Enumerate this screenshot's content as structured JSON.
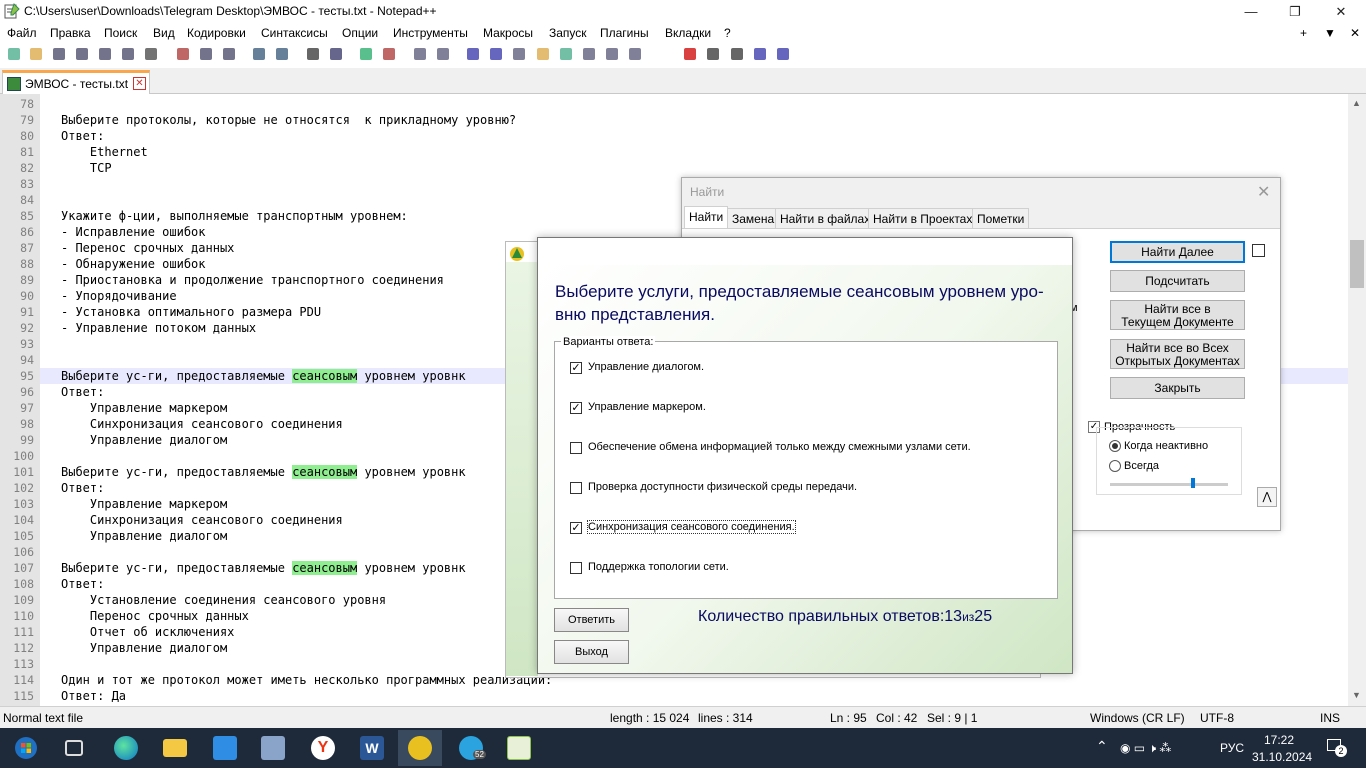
{
  "window": {
    "title": "C:\\Users\\user\\Downloads\\Telegram Desktop\\ЭМВОС - тесты.txt - Notepad++",
    "controls": [
      "—",
      "❐",
      "✕"
    ]
  },
  "menu": [
    "Файл",
    "Правка",
    "Поиск",
    "Вид",
    "Кодировки",
    "Синтаксисы",
    "Опции",
    "Инструменты",
    "Макросы",
    "Запуск",
    "Плагины",
    "Вкладки",
    "?"
  ],
  "menu_right": [
    "+",
    "▼",
    "✕"
  ],
  "tab": {
    "label": "ЭМВОС - тесты.txt"
  },
  "editor": {
    "lines": [
      {
        "n": "78",
        "t": ""
      },
      {
        "n": "79",
        "t": "Выберите протоколы, которые не относятся  к прикладному уровню?"
      },
      {
        "n": "80",
        "t": "Ответ:"
      },
      {
        "n": "81",
        "t": "    Ethernet"
      },
      {
        "n": "82",
        "t": "    TCP"
      },
      {
        "n": "83",
        "t": ""
      },
      {
        "n": "84",
        "t": ""
      },
      {
        "n": "85",
        "t": "Укажите ф-ции, выполняемые транспортным уровнем:"
      },
      {
        "n": "86",
        "t": "- Исправление ошибок"
      },
      {
        "n": "87",
        "t": "- Перенос срочных данных"
      },
      {
        "n": "88",
        "t": "- Обнаружение ошибок"
      },
      {
        "n": "89",
        "t": "- Приостановка и продолжение транспортного соединения"
      },
      {
        "n": "90",
        "t": "- Упорядочивание"
      },
      {
        "n": "91",
        "t": "- Установка оптимального размера PDU"
      },
      {
        "n": "92",
        "t": "- Управление потоком данных"
      },
      {
        "n": "93",
        "t": ""
      },
      {
        "n": "94",
        "t": ""
      },
      {
        "n": "95",
        "pre": "Выберите ус-ги, предоставляемые ",
        "hl": "сеансовым",
        "post": " уровнем уровнк"
      },
      {
        "n": "96",
        "t": "Ответ:"
      },
      {
        "n": "97",
        "t": "    Управление маркером"
      },
      {
        "n": "98",
        "t": "    Синхронизация сеансового соединения"
      },
      {
        "n": "99",
        "t": "    Управление диалогом"
      },
      {
        "n": "100",
        "t": ""
      },
      {
        "n": "101",
        "pre": "Выберите ус-ги, предоставляемые ",
        "hl": "сеансовым",
        "post": " уровнем уровнк"
      },
      {
        "n": "102",
        "t": "Ответ:"
      },
      {
        "n": "103",
        "t": "    Управление маркером"
      },
      {
        "n": "104",
        "t": "    Синхронизация сеансового соединения"
      },
      {
        "n": "105",
        "t": "    Управление диалогом"
      },
      {
        "n": "106",
        "t": ""
      },
      {
        "n": "107",
        "pre": "Выберите ус-ги, предоставляемые ",
        "hl": "сеансовым",
        "post": " уровнем уровнк"
      },
      {
        "n": "108",
        "t": "Ответ:"
      },
      {
        "n": "109",
        "t": "    Установление соединения сеансового уровня"
      },
      {
        "n": "110",
        "t": "    Перенос срочных данных"
      },
      {
        "n": "111",
        "t": "    Отчет об исключениях"
      },
      {
        "n": "112",
        "t": "    Управление диалогом"
      },
      {
        "n": "113",
        "t": ""
      },
      {
        "n": "114",
        "t": "Один и тот же протокол может иметь несколько программных реализации:"
      },
      {
        "n": "115",
        "t": "Ответ: Да"
      }
    ]
  },
  "find_dialog": {
    "title": "Найти",
    "tabs": [
      "Найти",
      "Замена",
      "Найти в файлах",
      "Найти в Проектах",
      "Пометки"
    ],
    "buttons": {
      "find_next": "Найти Далее",
      "count": "Подсчитать",
      "find_all_current": [
        "Найти все в",
        "Текущем Документе"
      ],
      "find_all_open": [
        "Найти все во Всех",
        "Открытых Документах"
      ],
      "close": "Закрыть"
    },
    "partial_label": "м",
    "transparency": "Прозрачность",
    "when_inactive": "Когда неактивно",
    "always": "Всегда"
  },
  "question_dialog": {
    "question": "Выберите услуги, предоставляемые сеансовым уровнем уро-вню представления.",
    "group_label": "Варианты ответа:",
    "options": [
      {
        "label": "Управление диалогом.",
        "checked": true
      },
      {
        "label": "Управление маркером.",
        "checked": true
      },
      {
        "label": "Обеспечение обмена информацией только между смежными узлами сети.",
        "checked": false
      },
      {
        "label": "Проверка доступности физической среды передачи.",
        "checked": false
      },
      {
        "label": "Синхронизация сеансового соединения.",
        "checked": true
      },
      {
        "label": "Поддержка топологии сети.",
        "checked": false
      }
    ],
    "answer_button": "Ответить",
    "exit_button": "Выход",
    "count_label": "Количество правильных ответов:",
    "count_value": "13",
    "count_of": "из",
    "count_total": "25"
  },
  "statusbar": {
    "type": "Normal text file",
    "length": "length : 15 024",
    "lines": "lines : 314",
    "ln": "Ln : 95",
    "col": "Col : 42",
    "sel": "Sel : 9 | 1",
    "eol": "Windows (CR LF)",
    "enc": "UTF-8",
    "mode": "INS"
  },
  "taskbar": {
    "lang": "РУС",
    "time": "17:22",
    "date": "31.10.2024",
    "notif": "2",
    "telegram_badge": "52"
  },
  "colors": {
    "accent": "#f9a64d",
    "highlight": "#8fee8f",
    "taskbar": "#1e2a3a",
    "dialog_title": "#0a0a60"
  }
}
